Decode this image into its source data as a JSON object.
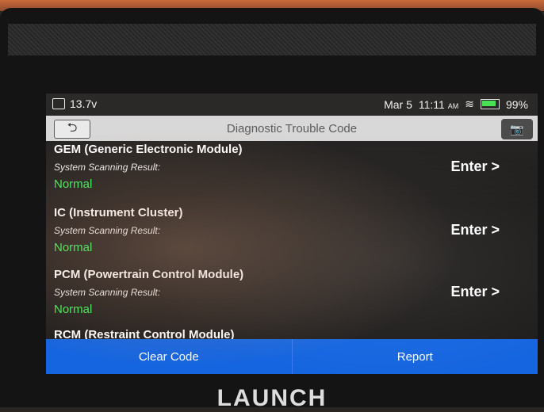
{
  "statusbar": {
    "voltage": "13.7v",
    "date": "Mar 5",
    "time": "11:11",
    "ampm": "AM",
    "battery": "99%"
  },
  "header": {
    "title": "Diagnostic Trouble Code"
  },
  "modules": [
    {
      "name": "GEM (Generic Electronic Module)",
      "subtitle": "System Scanning Result:",
      "status": "Normal",
      "action": "Enter >"
    },
    {
      "name": "IC (Instrument Cluster)",
      "subtitle": "System Scanning Result:",
      "status": "Normal",
      "action": "Enter >"
    },
    {
      "name": "PCM (Powertrain Control Module)",
      "subtitle": "System Scanning Result:",
      "status": "Normal",
      "action": "Enter >"
    },
    {
      "name": "RCM (Restraint Control Module)"
    }
  ],
  "footer": {
    "clear_code": "Clear Code",
    "report": "Report"
  },
  "device": {
    "brand": "LAUNCH"
  },
  "colors": {
    "status_normal": "#3ff05a",
    "bottom_bar": "#1565e0"
  }
}
